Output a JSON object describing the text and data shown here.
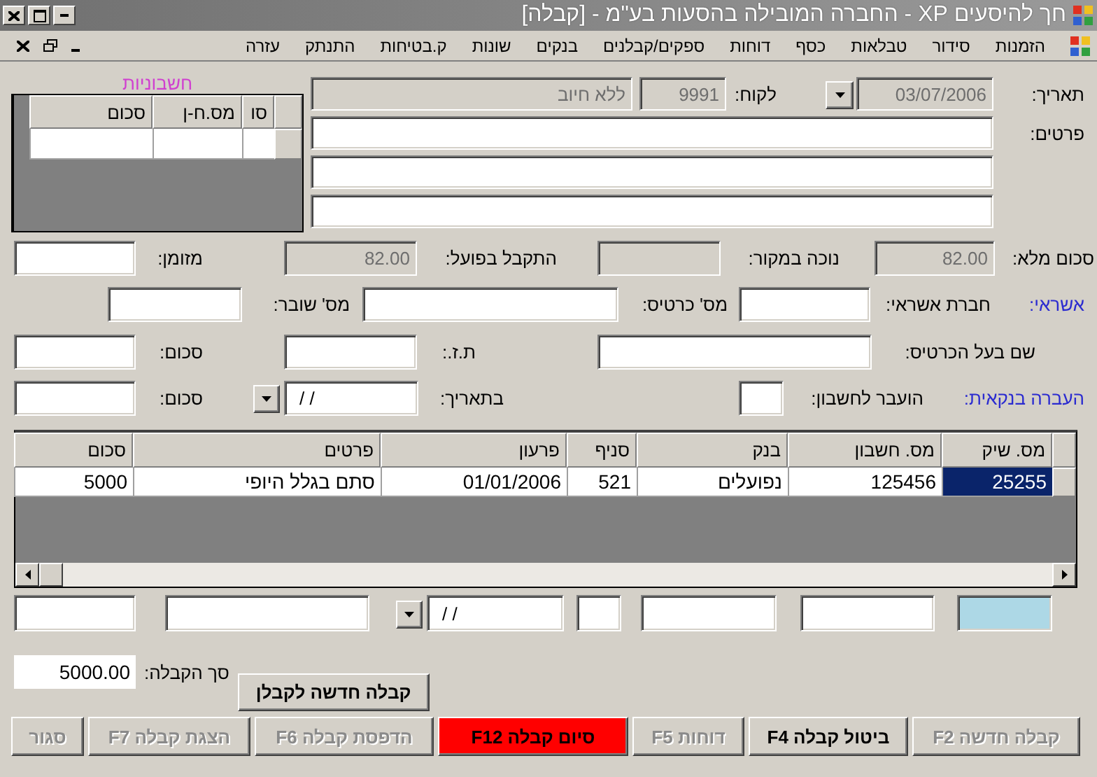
{
  "window": {
    "title": "חך להיסעים XP - החברה המובילה בהסעות בע\"מ - [קבלה]"
  },
  "menu": [
    "הזמנות",
    "סידור",
    "טבלאות",
    "כסף",
    "דוחות",
    "ספקים/קבלנים",
    "בנקים",
    "שונות",
    "ק.בטיחות",
    "התנתק",
    "עזרה"
  ],
  "invoices": {
    "title": "חשבוניות",
    "columns": [
      "סו",
      "מס.ח-ן",
      "סכום"
    ]
  },
  "details_rows": [
    {
      "items": [
        {
          "kind": "label",
          "text": "תאריך:"
        },
        {
          "kind": "field",
          "value": "03/07/2006",
          "disabled": true
        },
        {
          "kind": "dropdown"
        },
        {
          "kind": "label",
          "text": "לקוח:"
        },
        {
          "kind": "field",
          "value": "9991",
          "disabled": true
        },
        {
          "kind": "field",
          "value": "ללא חיוב",
          "disabled": true
        }
      ]
    },
    {
      "items": [
        {
          "kind": "label",
          "text": "פרטים:"
        },
        {
          "kind": "field",
          "disabled": false
        }
      ]
    },
    {
      "items": [
        {
          "kind": "field",
          "disabled": false
        }
      ]
    },
    {
      "items": [
        {
          "kind": "field",
          "disabled": false
        }
      ]
    }
  ],
  "payment_rows": [
    {
      "items": [
        {
          "kind": "label",
          "text": "סכום מלא:"
        },
        {
          "kind": "field",
          "value": "82.00",
          "disabled": true
        },
        {
          "kind": "label",
          "text": "נוכה במקור:"
        },
        {
          "kind": "field",
          "disabled": true
        },
        {
          "kind": "label",
          "text": "התקבל בפועל:"
        },
        {
          "kind": "field",
          "value": "82.00",
          "disabled": true
        },
        {
          "kind": "label",
          "text": "מזומן:"
        },
        {
          "kind": "field",
          "disabled": false
        }
      ]
    },
    {
      "items": [
        {
          "kind": "section",
          "text": "אשראי:"
        },
        {
          "kind": "label",
          "text": "חברת אשראי:"
        },
        {
          "kind": "field",
          "disabled": false
        },
        {
          "kind": "label",
          "text": "מס' כרטיס:"
        },
        {
          "kind": "field",
          "disabled": false
        },
        {
          "kind": "label",
          "text": "מס' שובר:"
        },
        {
          "kind": "field",
          "disabled": false
        }
      ]
    },
    {
      "items": [
        {
          "kind": "label",
          "text": "שם בעל הכרטיס:"
        },
        {
          "kind": "field",
          "disabled": false
        },
        {
          "kind": "label",
          "text": "ת.ז.:"
        },
        {
          "kind": "field",
          "disabled": false
        },
        {
          "kind": "label",
          "text": "סכום:"
        },
        {
          "kind": "field",
          "disabled": false
        }
      ]
    },
    {
      "items": [
        {
          "kind": "section",
          "text": "העברה בנקאית:"
        },
        {
          "kind": "label",
          "text": "הועבר לחשבון:"
        },
        {
          "kind": "field",
          "disabled": false
        },
        {
          "kind": "label",
          "text": "בתאריך:"
        },
        {
          "kind": "mask",
          "value": "/ /",
          "disabled": false
        },
        {
          "kind": "dropdown"
        },
        {
          "kind": "label",
          "text": "סכום:"
        },
        {
          "kind": "field",
          "disabled": false
        }
      ]
    }
  ],
  "checks": {
    "columns": [
      "מס. שיק",
      "מס. חשבון",
      "בנק",
      "סניף",
      "פרעון",
      "פרטים",
      "סכום"
    ],
    "rows": [
      {
        "cells": [
          "25255",
          "125456",
          "נפועלים",
          "521",
          "01/01/2006",
          "סתם בגלל היופי",
          "5000"
        ],
        "selected": true
      }
    ]
  },
  "check_entry": [
    {
      "kind": "field",
      "disabled": false,
      "highlighted": true
    },
    {
      "kind": "field",
      "disabled": false,
      "highlighted": false
    },
    {
      "kind": "field",
      "disabled": false,
      "highlighted": false
    },
    {
      "kind": "field",
      "disabled": false,
      "highlighted": false
    },
    {
      "kind": "mask",
      "value": "/ /",
      "disabled": false,
      "highlighted": false
    },
    {
      "kind": "dropdown"
    },
    {
      "kind": "field",
      "disabled": false,
      "highlighted": false
    },
    {
      "kind": "field",
      "disabled": false,
      "highlighted": false
    }
  ],
  "total": {
    "label": "סך הקבלה:",
    "value": "5000.00"
  },
  "new_contractor_receipt_button": "קבלה חדשה לקבלן",
  "buttons": [
    {
      "label": "קבלה חדשה F2",
      "kind": "normal",
      "disabled": true
    },
    {
      "label": "ביטול קבלה F4",
      "kind": "normal",
      "disabled": false
    },
    {
      "label": "דוחות F5",
      "kind": "normal",
      "disabled": true
    },
    {
      "label": "סיום קבלה F12",
      "kind": "danger",
      "disabled": false
    },
    {
      "label": "הדפסת קבלה F6",
      "kind": "normal",
      "disabled": true
    },
    {
      "label": "הצגת קבלה F7",
      "kind": "normal",
      "disabled": true
    },
    {
      "label": "סגור",
      "kind": "normal",
      "disabled": true
    }
  ]
}
